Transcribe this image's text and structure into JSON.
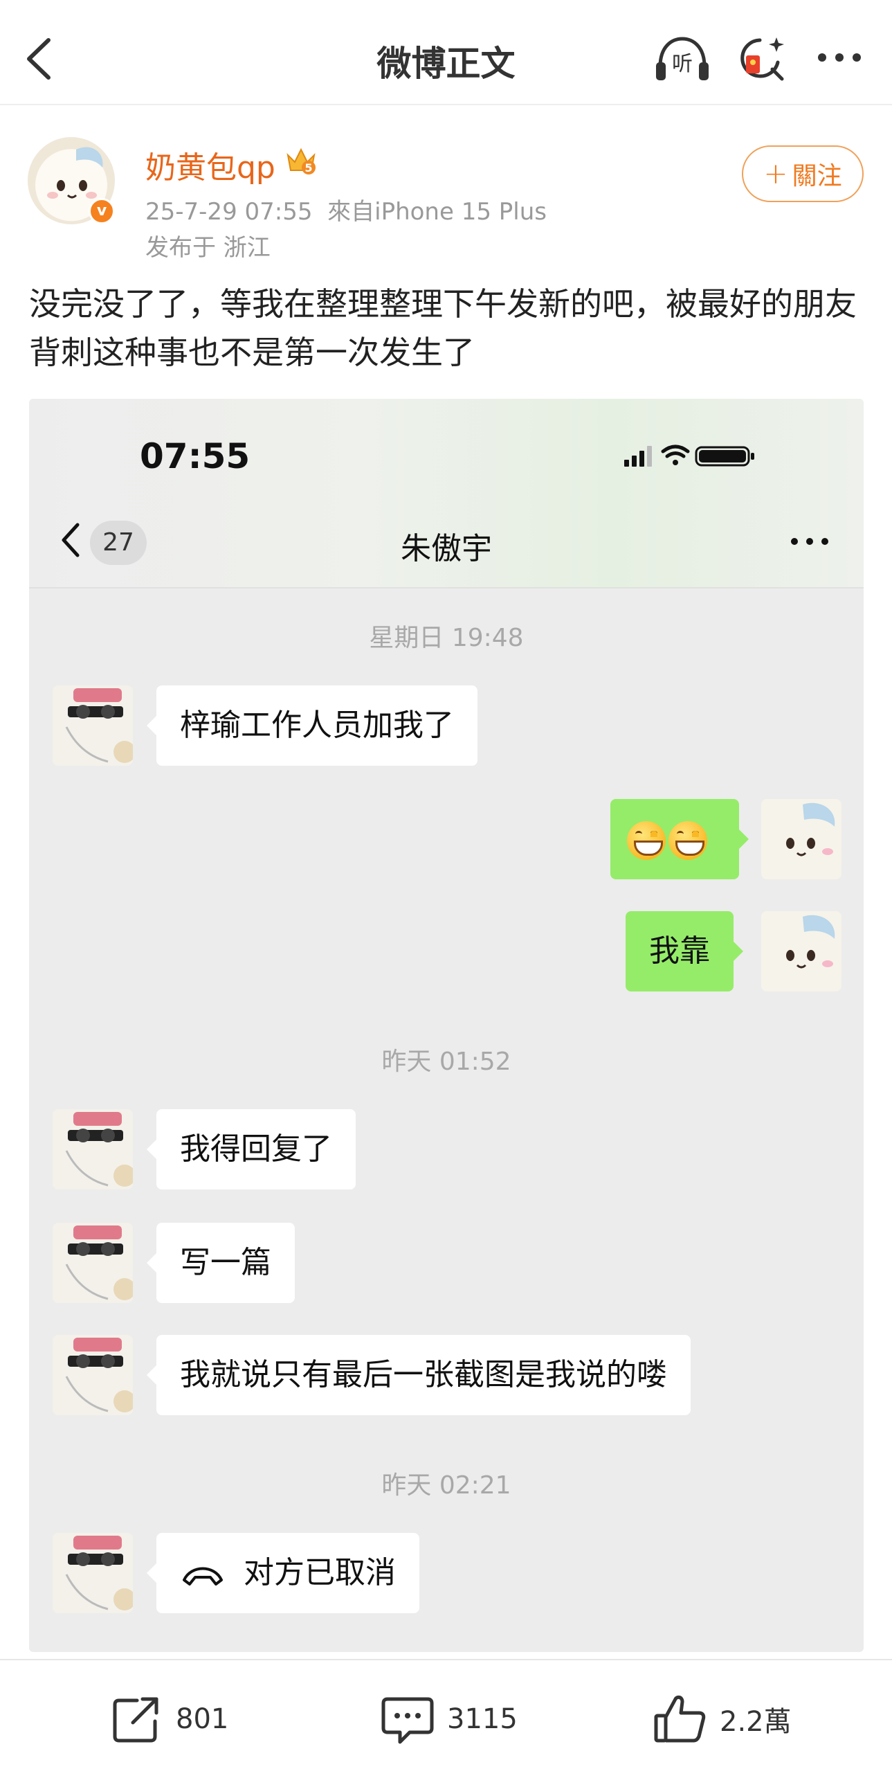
{
  "nav": {
    "title": "微博正文",
    "listen_label": "听"
  },
  "author": {
    "name": "奶黄包qp",
    "vip_level": "5",
    "verified_badge": "v",
    "meta_time": "25-7-29 07:55",
    "meta_source": "來自iPhone 15 Plus",
    "location": "发布于 浙江",
    "follow_label": "關注"
  },
  "post": {
    "text": "没完没了了，等我在整理整理下午发新的吧，被最好的朋友背刺这种事也不是第一次发生了"
  },
  "screenshot": {
    "clock": "07:55",
    "unread_count": "27",
    "chat_name": "朱傲宇",
    "messages": [
      {
        "type": "time",
        "text": "星期日 19:48"
      },
      {
        "type": "in",
        "text": "梓瑜工作人员加我了"
      },
      {
        "type": "out",
        "text": "😄😄"
      },
      {
        "type": "out",
        "text": "我靠"
      },
      {
        "type": "time",
        "text": "昨天 01:52"
      },
      {
        "type": "in",
        "text": "我得回复了"
      },
      {
        "type": "in",
        "text": "写一篇"
      },
      {
        "type": "in",
        "text": "我就说只有最后一张截图是我说的喽"
      },
      {
        "type": "time",
        "text": "昨天 02:21"
      },
      {
        "type": "in",
        "text": "对方已取消"
      }
    ]
  },
  "actions": {
    "repost_count": "801",
    "comment_count": "3115",
    "like_count": "2.2萬"
  },
  "colors": {
    "accent_orange": "#e8661a",
    "wechat_green": "#95ec69",
    "chat_bg": "#ececec"
  }
}
